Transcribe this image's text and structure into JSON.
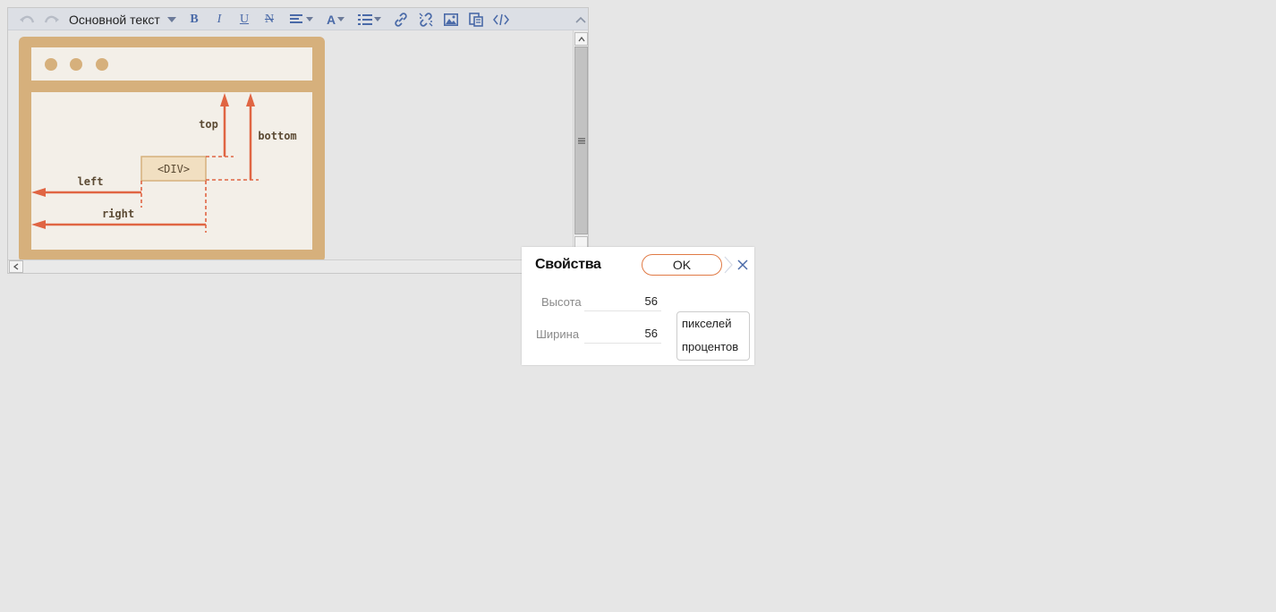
{
  "toolbar": {
    "format_select_value": "Основной текст",
    "bold_label": "B",
    "italic_label": "I",
    "underline_label": "U",
    "strike_label": "N",
    "font_color_label": "A",
    "icons": [
      "undo-icon",
      "redo-icon",
      "align-icon",
      "font-color-icon",
      "list-icon",
      "link-icon",
      "unlink-icon",
      "image-icon",
      "paste-icon",
      "code-icon",
      "collapse-icon"
    ]
  },
  "content": {
    "diagram": {
      "div_label": "<DIV>",
      "top_label": "top",
      "bottom_label": "bottom",
      "left_label": "left",
      "right_label": "right",
      "colors": {
        "frame": "#d6b07c",
        "inner": "#f3efe8",
        "arrow": "#e06543",
        "text": "#5b4a33"
      }
    }
  },
  "dialog": {
    "title": "Свойства",
    "ok_label": "OK",
    "height_label": "Высота",
    "height_value": "56",
    "width_label": "Ширина",
    "width_value": "56",
    "units": [
      "пикселей",
      "процентов"
    ],
    "accent_color": "#e07a45"
  }
}
